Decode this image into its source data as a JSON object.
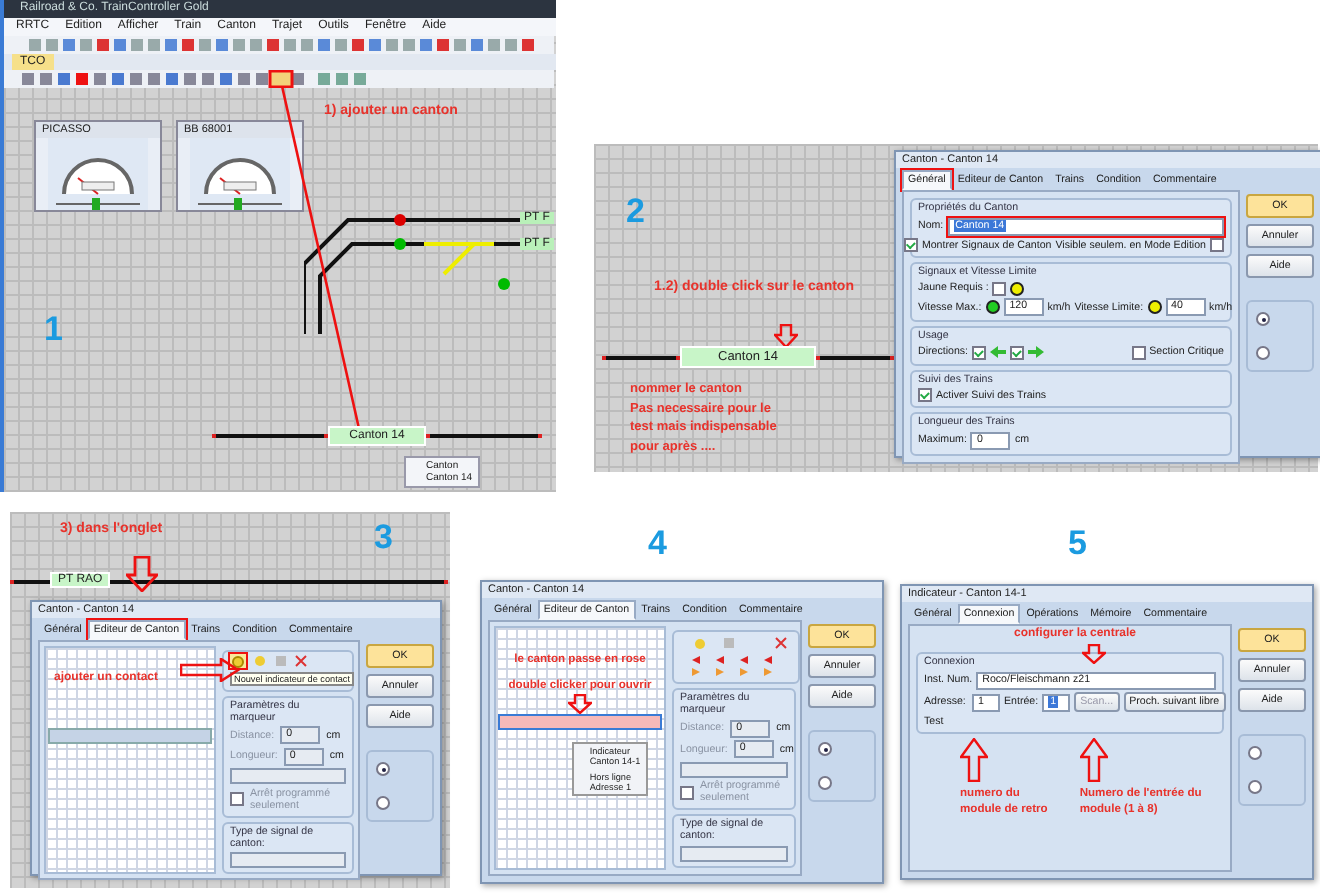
{
  "layout_window": {
    "number": "1",
    "title": "Railroad & Co. TrainController Gold",
    "menu": [
      "RRTC",
      "Edition",
      "Afficher",
      "Train",
      "Canton",
      "Trajet",
      "Outils",
      "Fenêtre",
      "Aide"
    ],
    "tab": "TCO",
    "annotation": "1) ajouter un canton",
    "locos": [
      {
        "name": "PICASSO"
      },
      {
        "name": "BB 68001"
      }
    ],
    "track_labels": [
      "PT F",
      "PT F"
    ],
    "block": "Canton 14",
    "tooltip": [
      "Canton",
      "Canton 14"
    ]
  },
  "step_2": {
    "number": "2",
    "annotation": "1.2) double click sur le canton",
    "block": "Canton 14",
    "notes": [
      "nommer le canton",
      "Pas necessaire pour le",
      "test mais indispensable",
      "pour après ...."
    ],
    "dialog": {
      "title": "Canton - Canton 14",
      "tabs": [
        {
          "label": "Général",
          "selected": true,
          "framed": true
        },
        {
          "label": "Editeur de Canton",
          "selected": false,
          "framed": false
        },
        {
          "label": "Trains",
          "selected": false,
          "framed": false
        },
        {
          "label": "Condition",
          "selected": false,
          "framed": false
        },
        {
          "label": "Commentaire",
          "selected": false,
          "framed": false
        }
      ],
      "buttons": [
        "OK",
        "Annuler",
        "Aide"
      ],
      "side_radios": [
        {
          "selected": true
        },
        {
          "selected": false
        }
      ],
      "properties_title": "Propriétés du Canton",
      "name_label": "Nom:",
      "name_value": "Canton 14",
      "name_framed": true,
      "show_signals": {
        "label": "Montrer Signaux de Canton",
        "checked": true
      },
      "edit_only": {
        "label": "Visible seulem. en Mode Edition",
        "checked": false
      },
      "signals_title": "Signaux et Vitesse Limite",
      "yellow": {
        "label": "Jaune Requis :",
        "checked": false
      },
      "max_label": "Vitesse Max.:",
      "max_value": "120",
      "max_unit": "km/h",
      "limit_label": "Vitesse Limite:",
      "limit_value": "40",
      "limit_unit": "km/h",
      "usage_title": "Usage",
      "directions_label": "Directions:",
      "directions": [
        {
          "checked": true
        },
        {
          "checked": true
        }
      ],
      "critical": {
        "label": "Section Critique",
        "checked": false
      },
      "tracking_title": "Suivi des Trains",
      "tracking": {
        "label": "Activer Suivi des Trains",
        "checked": true
      },
      "length_title": "Longueur des Trains",
      "length_label": "Maximum:",
      "length_value": "0",
      "length_unit": "cm"
    }
  },
  "step_3": {
    "number": "3",
    "annotation": "3) dans l'onglet",
    "contact_note": "ajouter un contact",
    "track_label": "PT RAO",
    "dialog": {
      "title": "Canton - Canton 14",
      "tabs": [
        {
          "label": "Général",
          "selected": false,
          "framed": false
        },
        {
          "label": "Editeur de Canton",
          "selected": true,
          "framed": true
        },
        {
          "label": "Trains",
          "selected": false,
          "framed": false
        },
        {
          "label": "Condition",
          "selected": false,
          "framed": false
        },
        {
          "label": "Commentaire",
          "selected": false,
          "framed": false
        }
      ],
      "buttons": [
        "OK",
        "Annuler",
        "Aide"
      ],
      "side_radios": [
        {
          "selected": true
        },
        {
          "selected": false
        }
      ],
      "tool_framed": true,
      "tool_tooltip": "Nouvel indicateur de contact",
      "marker_title": "Paramètres du marqueur",
      "distance_label": "Distance:",
      "distance_value": "0",
      "distance_unit": "cm",
      "length_label": "Longueur:",
      "length_value": "0",
      "length_unit": "cm",
      "stop": {
        "label": "Arrêt programmé seulement",
        "checked": false
      },
      "signal_type_title": "Type de signal de canton:"
    }
  },
  "step_4": {
    "number": "4",
    "pink_note": "le canton passe en rose",
    "open_note": "double clicker pour ouvrir",
    "block_highlighted": true,
    "popup": [
      "Indicateur",
      "Canton 14-1",
      "Hors ligne",
      "Adresse 1"
    ],
    "dialog": {
      "title": "Canton - Canton 14",
      "tabs": [
        {
          "label": "Général",
          "selected": false
        },
        {
          "label": "Editeur de Canton",
          "selected": true
        },
        {
          "label": "Trains",
          "selected": false
        },
        {
          "label": "Condition",
          "selected": false
        },
        {
          "label": "Commentaire",
          "selected": false
        }
      ],
      "buttons": [
        "OK",
        "Annuler",
        "Aide"
      ],
      "side_radios": [
        {
          "selected": true
        },
        {
          "selected": false
        }
      ],
      "marker_title": "Paramètres du marqueur",
      "distance_label": "Distance:",
      "distance_value": "0",
      "distance_unit": "cm",
      "length_label": "Longueur:",
      "length_value": "0",
      "length_unit": "cm",
      "stop": {
        "label": "Arrêt programmé seulement",
        "checked": false
      },
      "signal_type_title": "Type de signal de canton:"
    }
  },
  "step_5": {
    "number": "5",
    "annotation": "configurer la centrale",
    "module_note": [
      "numero du",
      "module de retro"
    ],
    "input_note": [
      "Numero de l'entrée du",
      "module (1 à 8)"
    ],
    "dialog": {
      "title": "Indicateur - Canton 14-1",
      "tabs": [
        {
          "label": "Général",
          "selected": false
        },
        {
          "label": "Connexion",
          "selected": true
        },
        {
          "label": "Opérations",
          "selected": false
        },
        {
          "label": "Mémoire",
          "selected": false
        },
        {
          "label": "Commentaire",
          "selected": false
        }
      ],
      "buttons": [
        "OK",
        "Annuler",
        "Aide"
      ],
      "side_radios": [
        {
          "selected": false
        },
        {
          "selected": false
        }
      ],
      "group_title": "Connexion",
      "inst_label": "Inst. Num.",
      "inst_value": "Roco/Fleischmann z21",
      "address_label": "Adresse:",
      "address_value": "1",
      "input_label": "Entrée:",
      "input_value": "1",
      "scan": "Scan...",
      "next": "Proch. suivant libre",
      "test_label": "Test"
    }
  }
}
